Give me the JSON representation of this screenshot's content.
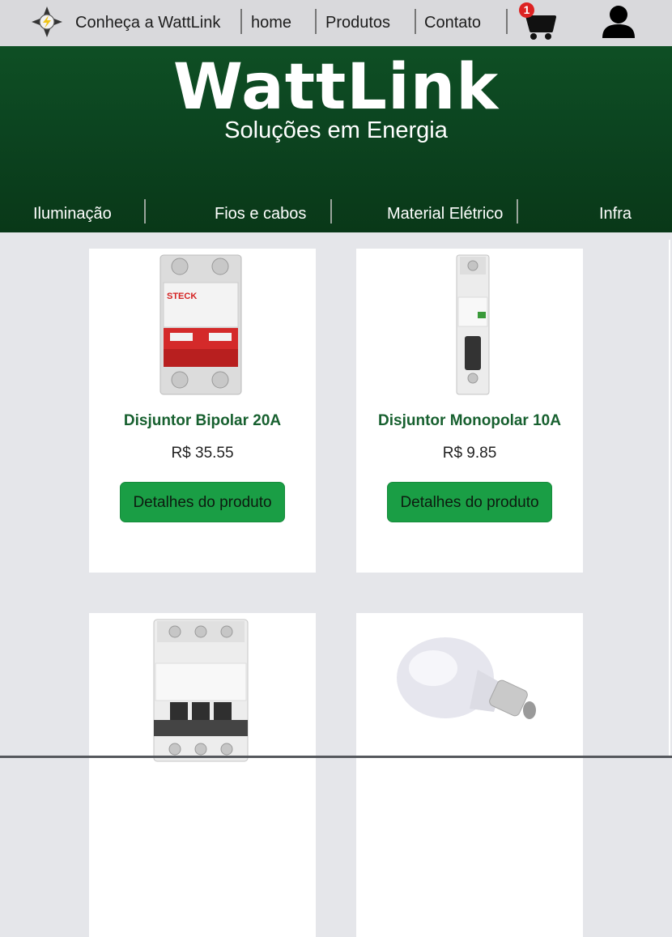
{
  "topnav": {
    "about_label": "Conheça a WattLink",
    "links": [
      "home",
      "Produtos",
      "Contato"
    ],
    "cart_count": "1",
    "icons": {
      "logo": "compass-bolt-icon",
      "cart": "cart-icon",
      "user": "user-icon"
    }
  },
  "hero": {
    "brand": "WattLink",
    "tagline": "Soluções em Energia",
    "categories": [
      "Iluminação",
      "Fios e cabos",
      "Material Elétrico",
      "Infra"
    ]
  },
  "products": [
    {
      "name": "Disjuntor Bipolar 20A",
      "price": "R$ 35.55",
      "button": "Detalhes do produto"
    },
    {
      "name": "Disjuntor Monopolar 10A",
      "price": "R$ 9.85",
      "button": "Detalhes do produto"
    },
    {
      "name": "",
      "price": "",
      "button": ""
    },
    {
      "name": "",
      "price": "",
      "button": ""
    }
  ],
  "colors": {
    "brand_green": "#0e4f24",
    "button_green": "#1a9e45",
    "title_green": "#17602f",
    "badge_red": "#dd2222"
  }
}
